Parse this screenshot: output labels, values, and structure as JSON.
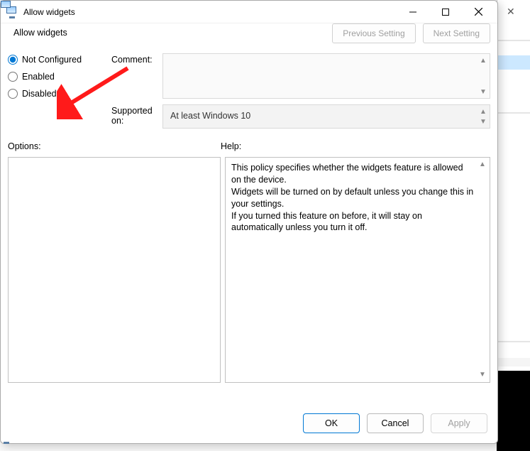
{
  "titlebar": {
    "title": "Allow widgets"
  },
  "policy": {
    "name": "Allow widgets"
  },
  "nav": {
    "previous": "Previous Setting",
    "next": "Next Setting"
  },
  "state": {
    "not_configured": "Not Configured",
    "enabled": "Enabled",
    "disabled": "Disabled",
    "selected": "not_configured"
  },
  "labels": {
    "comment": "Comment:",
    "supported": "Supported on:",
    "options": "Options:",
    "help": "Help:"
  },
  "comment": "",
  "supported_text": "At least Windows 10",
  "options_text": "",
  "help_text": "This policy specifies whether the widgets feature is allowed on the device.\nWidgets will be turned on by default unless you change this in your settings.\nIf you turned this feature on before, it will stay on automatically unless you turn it off.",
  "buttons": {
    "ok": "OK",
    "cancel": "Cancel",
    "apply": "Apply"
  }
}
